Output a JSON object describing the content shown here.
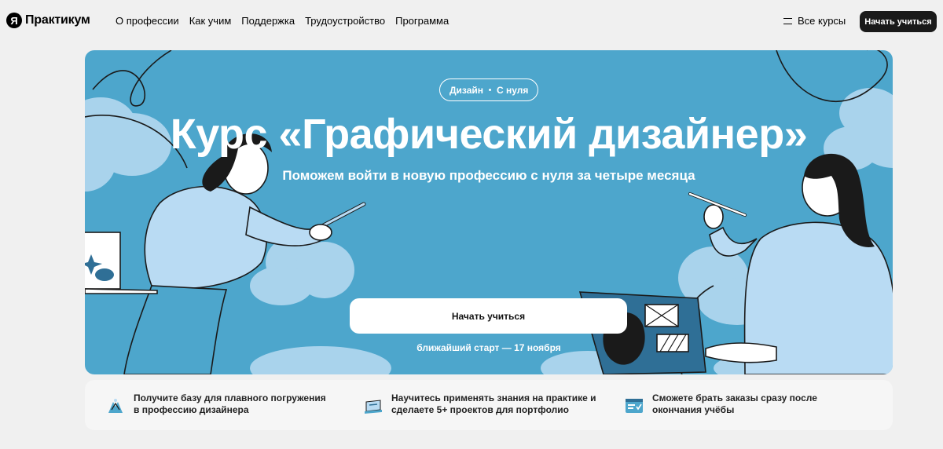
{
  "header": {
    "logo_mark": "Я",
    "logo_text": "Практикум",
    "nav": [
      "О профессии",
      "Как учим",
      "Поддержка",
      "Трудоустройство",
      "Программа"
    ],
    "all_courses": "Все курсы",
    "cta": "Начать учиться"
  },
  "hero": {
    "tag_left": "Дизайн",
    "tag_right": "С нуля",
    "title": "Курс «Графический дизайнер»",
    "subtitle": "Поможем войти в новую профессию с нуля за четыре месяца",
    "cta": "Начать учиться",
    "start_date": "ближайший старт — 17 ноября",
    "colors": {
      "background": "#4da6cc",
      "cloud": "#a9d3ec",
      "shirt": "#b9dbf3"
    }
  },
  "benefits": [
    {
      "icon": "hands-icon",
      "text": "Получите базу для плавного погружения в профессию дизайнера"
    },
    {
      "icon": "laptop-icon",
      "text": "Научитесь применять знания на практике и сделаете 5+ проектов для портфолио"
    },
    {
      "icon": "browser-window-icon",
      "text": "Сможете брать заказы сразу после окончания учёбы"
    }
  ]
}
